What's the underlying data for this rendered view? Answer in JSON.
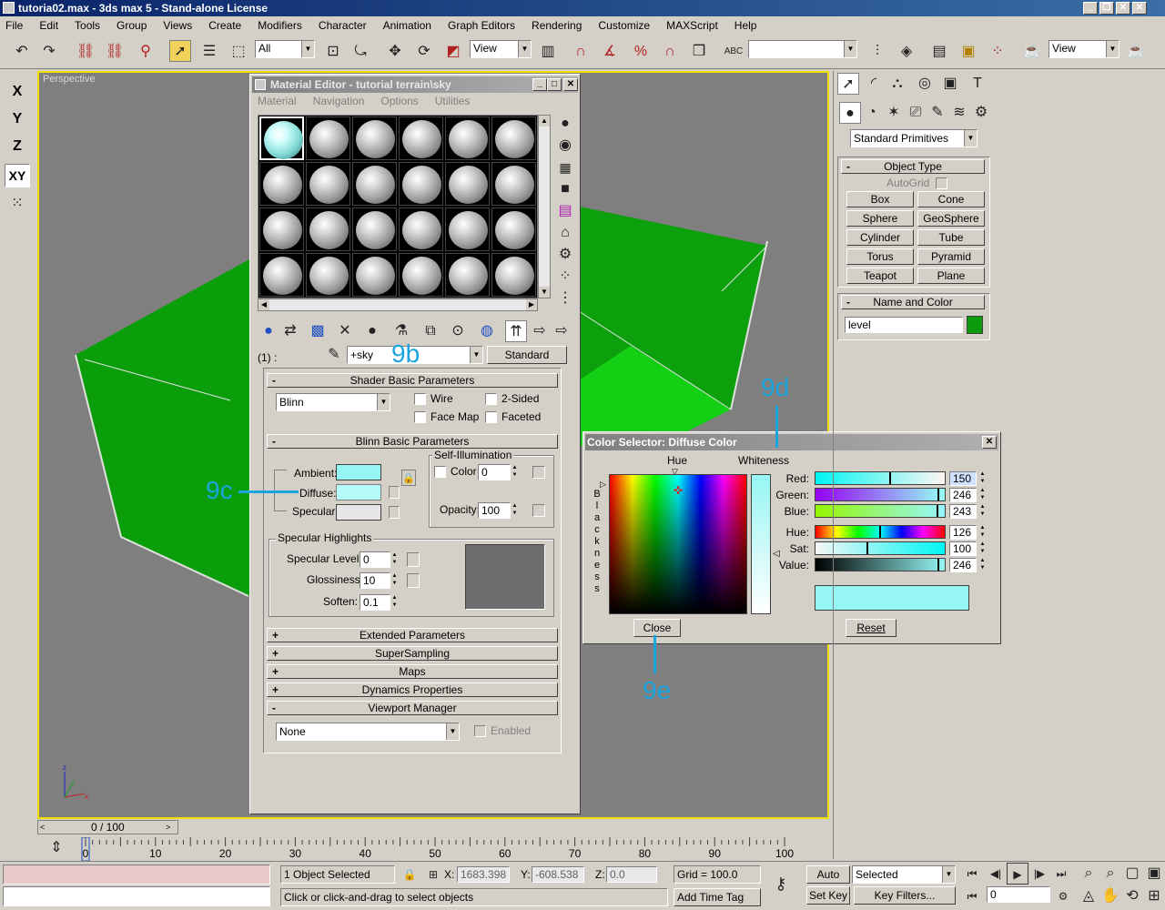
{
  "window": {
    "title": "tutoria02.max - 3ds max 5 - Stand-alone License"
  },
  "menubar": [
    "File",
    "Edit",
    "Tools",
    "Group",
    "Views",
    "Create",
    "Modifiers",
    "Character",
    "Animation",
    "Graph Editors",
    "Rendering",
    "Customize",
    "MAXScript",
    "Help"
  ],
  "toolbar": {
    "selection_filter": "All",
    "ref_coord": "View",
    "named_sel": "",
    "render_view": "View"
  },
  "axis_buttons": [
    "X",
    "Y",
    "Z",
    "XY"
  ],
  "viewport": {
    "label": "Perspective",
    "bg": "#7f7f7f",
    "mesh_color": "#0c9b0c"
  },
  "material_editor": {
    "title": "Material Editor - tutorial terrain\\sky",
    "menu": [
      "Material",
      "Navigation",
      "Options",
      "Utilities"
    ],
    "slot_label": "(1) :",
    "mat_name": "+sky",
    "mat_type": "Standard",
    "shader_rollout": "Shader Basic Parameters",
    "shader": "Blinn",
    "wire": "Wire",
    "two_sided": "2-Sided",
    "face_map": "Face Map",
    "faceted": "Faceted",
    "blinn_rollout": "Blinn Basic Parameters",
    "self_illum": "Self-Illumination",
    "color_label": "Color",
    "color_value": "0",
    "ambient": "Ambient:",
    "diffuse": "Diffuse:",
    "specular": "Specular:",
    "opacity_label": "Opacity:",
    "opacity_value": "100",
    "spec_highlights": "Specular Highlights",
    "spec_level_label": "Specular Level:",
    "spec_level": "0",
    "gloss_label": "Glossiness:",
    "gloss": "10",
    "soften_label": "Soften:",
    "soften": "0.1",
    "rollouts": [
      "Extended Parameters",
      "SuperSampling",
      "Maps",
      "Dynamics Properties"
    ],
    "viewport_manager": "Viewport Manager",
    "vm_value": "None",
    "enabled": "Enabled",
    "swatch_color": "#96f6f3"
  },
  "color_selector": {
    "title": "Color Selector: Diffuse Color",
    "hue_label": "Hue",
    "whiteness_label": "Whiteness",
    "blackness_label": "Blackness",
    "rows": [
      {
        "label": "Red:",
        "value": "150"
      },
      {
        "label": "Green:",
        "value": "246"
      },
      {
        "label": "Blue:",
        "value": "243"
      },
      {
        "label": "Hue:",
        "value": "126"
      },
      {
        "label": "Sat:",
        "value": "100"
      },
      {
        "label": "Value:",
        "value": "246"
      }
    ],
    "close": "Close",
    "reset": "Reset",
    "color": "#96f6f3"
  },
  "command_panel": {
    "dropdown": "Standard Primitives",
    "object_type": "Object Type",
    "autogrid": "AutoGrid",
    "buttons": [
      "Box",
      "Cone",
      "Sphere",
      "GeoSphere",
      "Cylinder",
      "Tube",
      "Torus",
      "Pyramid",
      "Teapot",
      "Plane"
    ],
    "name_and_color": "Name and Color",
    "name": "level",
    "object_color": "#0c9b0c"
  },
  "timeline": {
    "frame": "0 / 100",
    "ticks": [
      "0",
      "10",
      "20",
      "30",
      "40",
      "50",
      "60",
      "70",
      "80",
      "90",
      "100"
    ]
  },
  "status": {
    "selected": "1 Object Selected",
    "prompt": "Click or click-and-drag to select objects",
    "x_label": "X:",
    "x": "1683.398",
    "y_label": "Y:",
    "y": "-608.538",
    "z_label": "Z:",
    "z": "0.0",
    "grid": "Grid = 100.0",
    "add_time_tag": "Add Time Tag",
    "auto_key": "Auto Key",
    "set_key": "Set Key",
    "key_mode": "Selected",
    "key_filters": "Key Filters...",
    "frame_field": "0"
  },
  "annotations": [
    "9b",
    "9c",
    "9d",
    "9e"
  ]
}
